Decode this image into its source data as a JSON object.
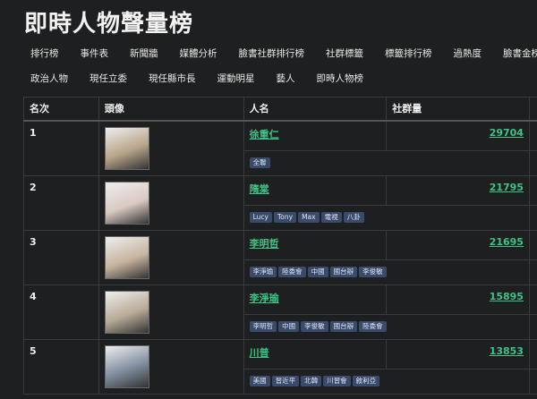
{
  "title": "即時人物聲量榜",
  "nav_row1": [
    "排行榜",
    "事件表",
    "新聞牆",
    "媒體分析",
    "臉書社群排行榜",
    "社群標籤",
    "標籤排行榜",
    "過熱度",
    "臉書金榜"
  ],
  "nav_row2": [
    "政治人物",
    "現任立委",
    "現任縣市長",
    "運動明星",
    "藝人",
    "即時人物榜"
  ],
  "table": {
    "headers": [
      "名次",
      "頭像",
      "人名",
      "社群量"
    ],
    "rows": [
      {
        "rank": "1",
        "name": "徐重仁",
        "count": "29704",
        "tags": [
          "全聯"
        ],
        "avatar_color": "#b8a48a"
      },
      {
        "rank": "2",
        "name": "隋棠",
        "count": "21795",
        "tags": [
          "Lucy",
          "Tony",
          "Max",
          "電視",
          "八卦"
        ],
        "avatar_color": "#d9c9c2"
      },
      {
        "rank": "3",
        "name": "李明哲",
        "count": "21695",
        "tags": [
          "李淨瑜",
          "陸委會",
          "中國",
          "國台辦",
          "李俊敏"
        ],
        "avatar_color": "#c7b49e"
      },
      {
        "rank": "4",
        "name": "李淨瑜",
        "count": "15895",
        "tags": [
          "李明哲",
          "中國",
          "李俊敏",
          "國台辦",
          "陸委會"
        ],
        "avatar_color": "#b7aa96"
      },
      {
        "rank": "5",
        "name": "川普",
        "count": "13853",
        "tags": [
          "美國",
          "習近平",
          "北韓",
          "川習會",
          "敘利亞"
        ],
        "avatar_color": "#7f8d9e"
      }
    ]
  }
}
